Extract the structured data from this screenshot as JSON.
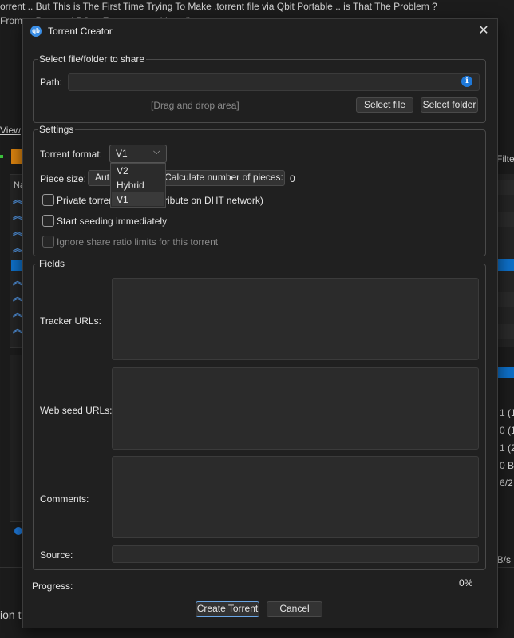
{
  "background": {
    "line1": "orrent .. But This is The First Time Trying To Make .torrent file via Qbit Portable .. is That The Problem ?",
    "line2": "From ... Powered PC to Format ... and Install",
    "view_menu": "View",
    "filter_label": "Filte",
    "column_header": "Na",
    "right_values": [
      "1 (1",
      "0 (1",
      "1 (2",
      "0 B",
      "6/2"
    ],
    "speed_value": "iB/s",
    "bottom_text": "ion t"
  },
  "dialog": {
    "title": "Torrent Creator",
    "select_group": {
      "title": "Select file/folder to share",
      "path_label": "Path:",
      "path_value": "",
      "drag_drop": "[Drag and drop area]",
      "select_file": "Select file",
      "select_folder": "Select folder"
    },
    "settings_group": {
      "title": "Settings",
      "torrent_format_label": "Torrent format:",
      "torrent_format_value": "V1",
      "format_options": [
        "V2",
        "Hybrid",
        "V1"
      ],
      "piece_size_label": "Piece size:",
      "piece_size_value": "Aut",
      "calc_pieces_button": "Calculate number of pieces:",
      "pieces_count": "0",
      "private_label_left": "Private torrer",
      "private_label_right": "ribute on DHT network)",
      "start_seeding_label": "Start seeding immediately",
      "ignore_ratio_label": "Ignore share ratio limits for this torrent"
    },
    "fields_group": {
      "title": "Fields",
      "tracker_label": "Tracker URLs:",
      "webseed_label": "Web seed URLs:",
      "comments_label": "Comments:",
      "source_label": "Source:"
    },
    "progress_label": "Progress:",
    "progress_percent": "0%",
    "progress_value": 0,
    "create_button": "Create Torrent",
    "cancel_button": "Cancel"
  }
}
